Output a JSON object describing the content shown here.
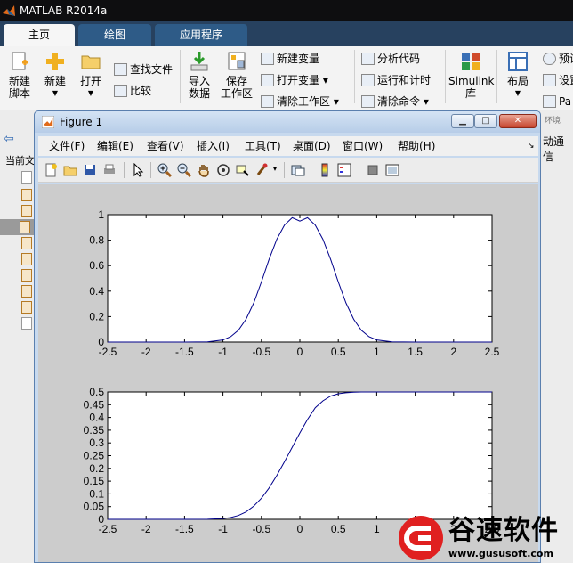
{
  "app": {
    "title": "MATLAB R2014a"
  },
  "tabs": [
    {
      "label": "主页",
      "active": true
    },
    {
      "label": "绘图",
      "active": false
    },
    {
      "label": "应用程序",
      "active": false
    }
  ],
  "ribbon": {
    "new_script": "新建\n脚本",
    "new": "新建",
    "open": "打开",
    "find_files": "查找文件",
    "compare": "比较",
    "import_data": "导入\n数据",
    "save_workspace": "保存\n工作区",
    "new_variable": "新建变量",
    "open_variable": "打开变量",
    "clear_workspace": "清除工作区",
    "analyze_code": "分析代码",
    "run_and_time": "运行和计时",
    "clear_commands": "清除命令",
    "simulink": "Simulink\n库",
    "layout": "布局",
    "preferences_partial": "预设",
    "set_path_partial": "设置",
    "parallel_partial": "Pa",
    "env_partial": "环境"
  },
  "side": {
    "current_folder_partial": "当前文",
    "cmd_partial": "动通信"
  },
  "figure": {
    "title": "Figure 1",
    "menu": [
      "文件(F)",
      "编辑(E)",
      "查看(V)",
      "插入(I)",
      "工具(T)",
      "桌面(D)",
      "窗口(W)",
      "帮助(H)"
    ]
  },
  "watermark": {
    "brand": "谷速软件",
    "url": "www.gususoft.com"
  },
  "colors": {
    "line": "#00008b",
    "titlebar": "#0e0e10",
    "tabbar": "#27415f",
    "figure_bg": "#cccccc"
  },
  "chart_data": [
    {
      "type": "line",
      "title": "",
      "xlabel": "",
      "ylabel": "",
      "xlim": [
        -2.5,
        2.5
      ],
      "ylim": [
        0,
        1
      ],
      "xticks": [
        "-2.5",
        "-2",
        "-1.5",
        "-1",
        "-0.5",
        "0",
        "0.5",
        "1",
        "1.5",
        "2",
        "2.5"
      ],
      "yticks": [
        "0",
        "0.2",
        "0.4",
        "0.6",
        "0.8",
        "1"
      ],
      "grid": false,
      "series": [
        {
          "x": [
            -2.5,
            -2.0,
            -1.5,
            -1.2,
            -1.0,
            -0.9,
            -0.8,
            -0.7,
            -0.6,
            -0.5,
            -0.4,
            -0.3,
            -0.2,
            -0.1,
            0.0,
            0.1,
            0.2,
            0.3,
            0.4,
            0.5,
            0.6,
            0.7,
            0.8,
            0.9,
            1.0,
            1.2,
            1.5,
            2.0,
            2.5
          ],
          "y": [
            0,
            0,
            0,
            0.002,
            0.017,
            0.042,
            0.092,
            0.179,
            0.308,
            0.472,
            0.649,
            0.807,
            0.918,
            0.976,
            0.95,
            0.976,
            0.918,
            0.807,
            0.649,
            0.472,
            0.308,
            0.179,
            0.092,
            0.042,
            0.017,
            0.002,
            0,
            0,
            0
          ]
        }
      ]
    },
    {
      "type": "line",
      "title": "",
      "xlabel": "",
      "ylabel": "",
      "xlim": [
        -2.5,
        2.5
      ],
      "ylim": [
        0,
        0.5
      ],
      "xticks": [
        "-2.5",
        "-2",
        "-1.5",
        "-1",
        "-0.5",
        "0",
        "0.5",
        "1",
        "1.5",
        "2",
        "2.5"
      ],
      "yticks": [
        "0",
        "0.05",
        "0.1",
        "0.15",
        "0.2",
        "0.25",
        "0.3",
        "0.35",
        "0.4",
        "0.45",
        "0.5"
      ],
      "grid": false,
      "series": [
        {
          "x": [
            -2.5,
            -2.0,
            -1.5,
            -1.2,
            -1.0,
            -0.9,
            -0.8,
            -0.7,
            -0.6,
            -0.5,
            -0.4,
            -0.3,
            -0.2,
            -0.1,
            0.0,
            0.1,
            0.2,
            0.3,
            0.4,
            0.5,
            0.6,
            0.7,
            0.8,
            0.9,
            1.0,
            1.2,
            1.5,
            2.0,
            2.5
          ],
          "y": [
            0,
            0,
            0,
            0.0005,
            0.003,
            0.007,
            0.015,
            0.029,
            0.052,
            0.083,
            0.123,
            0.172,
            0.226,
            0.283,
            0.339,
            0.392,
            0.438,
            0.465,
            0.484,
            0.493,
            0.497,
            0.499,
            0.5,
            0.5,
            0.5,
            0.5,
            0.5,
            0.5,
            0.5
          ]
        }
      ]
    }
  ]
}
